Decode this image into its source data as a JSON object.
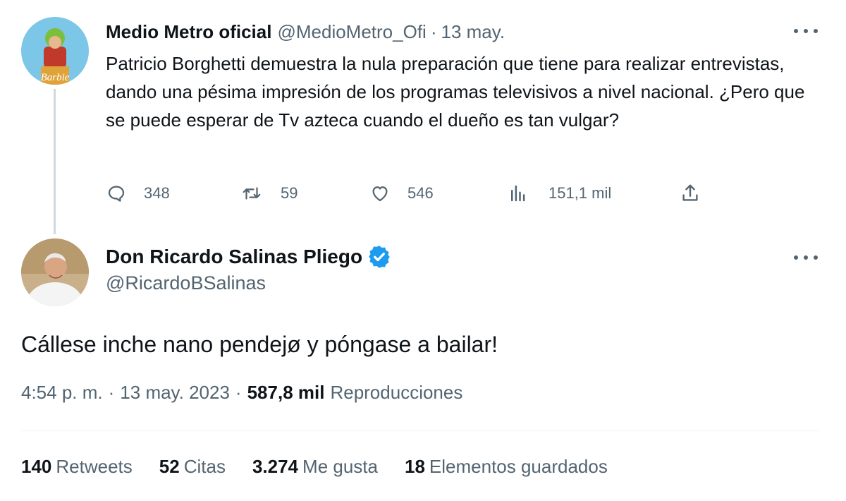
{
  "reply_tweet": {
    "author_name": "Medio Metro oficial",
    "handle": "@MedioMetro_Ofi",
    "separator": "·",
    "date": "13 may.",
    "avatar_text": "Barbie",
    "text": "Patricio Borghetti demuestra la nula preparación que tiene para realizar entrevistas, dando una pésima impresión de los programas televisivos a nivel nacional. ¿Pero que se puede esperar de Tv azteca cuando el dueño es tan vulgar?",
    "actions": {
      "replies": "348",
      "retweets": "59",
      "likes": "546",
      "views": "151,1 mil"
    }
  },
  "main_tweet": {
    "author_name": "Don Ricardo Salinas Pliego",
    "handle": "@RicardoBSalinas",
    "verified": true,
    "text": "Cállese inche nano pendejø y póngase a bailar!",
    "time": "4:54 p. m.",
    "separator": "·",
    "date": "13 may. 2023",
    "views_count": "587,8 mil",
    "views_label": "Reproducciones",
    "stats": {
      "retweets_count": "140",
      "retweets_label": "Retweets",
      "quotes_count": "52",
      "quotes_label": "Citas",
      "likes_count": "3.274",
      "likes_label": "Me gusta",
      "bookmarks_count": "18",
      "bookmarks_label": "Elementos guardados"
    }
  },
  "colors": {
    "text_primary": "#0f1419",
    "text_secondary": "#536471",
    "verified_blue": "#1d9bf0",
    "thread_line": "#cfd9de",
    "divider": "#eff3f4"
  },
  "icons": {
    "reply": "reply-icon",
    "retweet": "retweet-icon",
    "like": "heart-icon",
    "views": "analytics-icon",
    "share": "share-icon",
    "more": "more-icon",
    "verified": "verified-badge-icon"
  }
}
